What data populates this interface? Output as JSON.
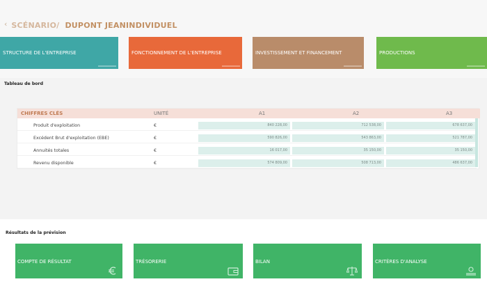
{
  "header": {
    "back_icon": "‹",
    "title_prefix": "SCÉNARIO/",
    "title_name": "DUPONT JEANINDIVIDUEL"
  },
  "tabs": [
    {
      "label": "STRUCTURE DE L'ENTREPRISE",
      "color": "#3fa7a6"
    },
    {
      "label": "FONCTIONNEMENT DE L'ENTREPRISE",
      "color": "#e8693a"
    },
    {
      "label": "INVESTISSEMENT ET FINANCEMENT",
      "color": "#b98c6a"
    },
    {
      "label": "PRODUCTIONS",
      "color": "#6fba4c"
    }
  ],
  "dashboard": {
    "label": "Tableau de bord",
    "headers": {
      "key": "CHIFFRES CLÉS",
      "unit": "UNITÉ",
      "a1": "A1",
      "a2": "A2",
      "a3": "A3"
    },
    "rows": [
      {
        "label": "Produit d'exploitation",
        "unit": "€",
        "a1": "840 228,00",
        "a2": "712 538,00",
        "a3": "678 637,00"
      },
      {
        "label": "Excédent Brut d'exploitation (EBE)",
        "unit": "€",
        "a1": "590 826,00",
        "a2": "543 863,00",
        "a3": "521 787,00"
      },
      {
        "label": "Annuités totales",
        "unit": "€",
        "a1": "16 017,00",
        "a2": "35 150,00",
        "a3": "35 150,00"
      },
      {
        "label": "Revenu disponible",
        "unit": "€",
        "a1": "574 809,00",
        "a2": "508 713,00",
        "a3": "486 637,00"
      }
    ]
  },
  "results": {
    "label": "Résultats de la prévision",
    "cards": [
      {
        "label": "COMPTE DE RÉSULTAT",
        "icon": "euro-icon"
      },
      {
        "label": "TRÉSORERIE",
        "icon": "wallet-icon"
      },
      {
        "label": "BILAN",
        "icon": "balance-scale-icon"
      },
      {
        "label": "CRITÈRES D'ANALYSE",
        "icon": "analysis-icon"
      }
    ]
  }
}
